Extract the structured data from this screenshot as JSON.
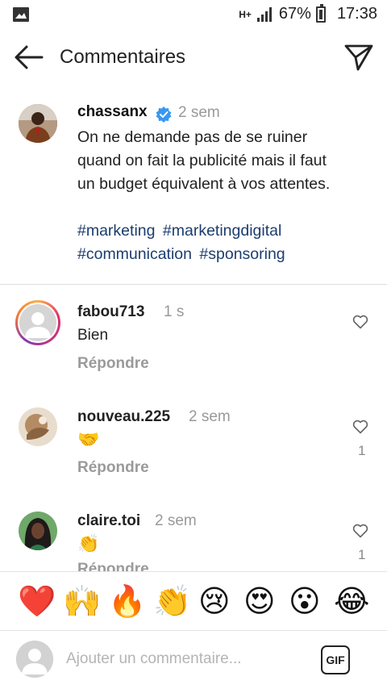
{
  "status_bar": {
    "network": "H+",
    "battery": "67%",
    "time": "17:38"
  },
  "header": {
    "title": "Commentaires"
  },
  "post": {
    "username": "chassanx",
    "time": "2 sem",
    "text": "On ne demande pas de se ruiner quand on fait la publicité mais il faut un budget équivalent à vos attentes.",
    "hashtags": [
      "#marketing",
      "#marketingdigital",
      "#communication",
      "#sponsoring"
    ]
  },
  "comments": [
    {
      "username": "fabou713",
      "time": "1 s",
      "text": "Bien",
      "reply_label": "Répondre",
      "likes": ""
    },
    {
      "username": "nouveau.225",
      "time": "2 sem",
      "text": "🤝",
      "reply_label": "Répondre",
      "likes": "1"
    },
    {
      "username": "claire.toi",
      "time": "2 sem",
      "text": "👏",
      "reply_label": "Répondre",
      "likes": "1"
    }
  ],
  "emoji_bar": [
    "❤️",
    "🙌",
    "🔥",
    "👏",
    "😢",
    "😍",
    "😮",
    "😂"
  ],
  "composer": {
    "placeholder": "Ajouter un commentaire...",
    "gif_label": "GIF"
  },
  "colors": {
    "hashtag": "#1c3d6e",
    "verified": "#3897f0",
    "muted": "#999999"
  }
}
